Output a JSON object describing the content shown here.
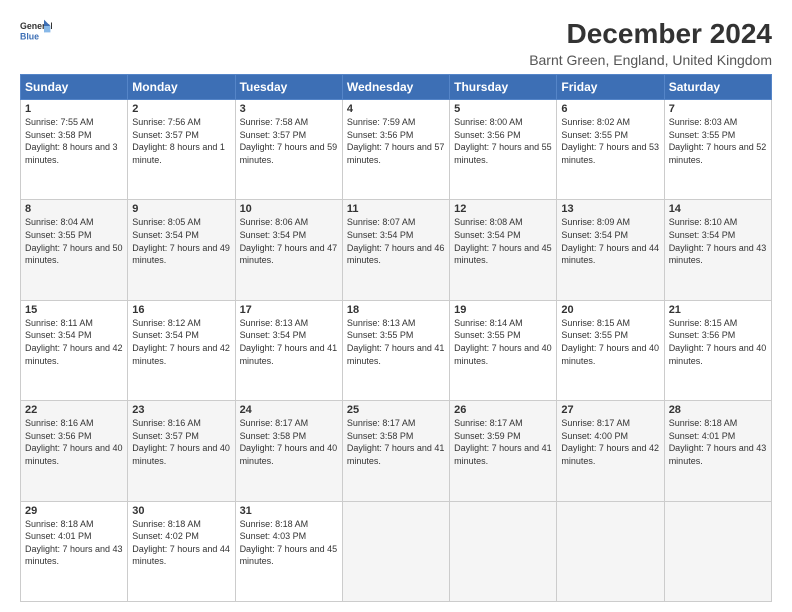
{
  "logo": {
    "line1": "General",
    "line2": "Blue"
  },
  "title": "December 2024",
  "subtitle": "Barnt Green, England, United Kingdom",
  "days_of_week": [
    "Sunday",
    "Monday",
    "Tuesday",
    "Wednesday",
    "Thursday",
    "Friday",
    "Saturday"
  ],
  "weeks": [
    [
      {
        "day": "1",
        "sunrise": "7:55 AM",
        "sunset": "3:58 PM",
        "daylight": "8 hours and 3 minutes."
      },
      {
        "day": "2",
        "sunrise": "7:56 AM",
        "sunset": "3:57 PM",
        "daylight": "8 hours and 1 minute."
      },
      {
        "day": "3",
        "sunrise": "7:58 AM",
        "sunset": "3:57 PM",
        "daylight": "7 hours and 59 minutes."
      },
      {
        "day": "4",
        "sunrise": "7:59 AM",
        "sunset": "3:56 PM",
        "daylight": "7 hours and 57 minutes."
      },
      {
        "day": "5",
        "sunrise": "8:00 AM",
        "sunset": "3:56 PM",
        "daylight": "7 hours and 55 minutes."
      },
      {
        "day": "6",
        "sunrise": "8:02 AM",
        "sunset": "3:55 PM",
        "daylight": "7 hours and 53 minutes."
      },
      {
        "day": "7",
        "sunrise": "8:03 AM",
        "sunset": "3:55 PM",
        "daylight": "7 hours and 52 minutes."
      }
    ],
    [
      {
        "day": "8",
        "sunrise": "8:04 AM",
        "sunset": "3:55 PM",
        "daylight": "7 hours and 50 minutes."
      },
      {
        "day": "9",
        "sunrise": "8:05 AM",
        "sunset": "3:54 PM",
        "daylight": "7 hours and 49 minutes."
      },
      {
        "day": "10",
        "sunrise": "8:06 AM",
        "sunset": "3:54 PM",
        "daylight": "7 hours and 47 minutes."
      },
      {
        "day": "11",
        "sunrise": "8:07 AM",
        "sunset": "3:54 PM",
        "daylight": "7 hours and 46 minutes."
      },
      {
        "day": "12",
        "sunrise": "8:08 AM",
        "sunset": "3:54 PM",
        "daylight": "7 hours and 45 minutes."
      },
      {
        "day": "13",
        "sunrise": "8:09 AM",
        "sunset": "3:54 PM",
        "daylight": "7 hours and 44 minutes."
      },
      {
        "day": "14",
        "sunrise": "8:10 AM",
        "sunset": "3:54 PM",
        "daylight": "7 hours and 43 minutes."
      }
    ],
    [
      {
        "day": "15",
        "sunrise": "8:11 AM",
        "sunset": "3:54 PM",
        "daylight": "7 hours and 42 minutes."
      },
      {
        "day": "16",
        "sunrise": "8:12 AM",
        "sunset": "3:54 PM",
        "daylight": "7 hours and 42 minutes."
      },
      {
        "day": "17",
        "sunrise": "8:13 AM",
        "sunset": "3:54 PM",
        "daylight": "7 hours and 41 minutes."
      },
      {
        "day": "18",
        "sunrise": "8:13 AM",
        "sunset": "3:55 PM",
        "daylight": "7 hours and 41 minutes."
      },
      {
        "day": "19",
        "sunrise": "8:14 AM",
        "sunset": "3:55 PM",
        "daylight": "7 hours and 40 minutes."
      },
      {
        "day": "20",
        "sunrise": "8:15 AM",
        "sunset": "3:55 PM",
        "daylight": "7 hours and 40 minutes."
      },
      {
        "day": "21",
        "sunrise": "8:15 AM",
        "sunset": "3:56 PM",
        "daylight": "7 hours and 40 minutes."
      }
    ],
    [
      {
        "day": "22",
        "sunrise": "8:16 AM",
        "sunset": "3:56 PM",
        "daylight": "7 hours and 40 minutes."
      },
      {
        "day": "23",
        "sunrise": "8:16 AM",
        "sunset": "3:57 PM",
        "daylight": "7 hours and 40 minutes."
      },
      {
        "day": "24",
        "sunrise": "8:17 AM",
        "sunset": "3:58 PM",
        "daylight": "7 hours and 40 minutes."
      },
      {
        "day": "25",
        "sunrise": "8:17 AM",
        "sunset": "3:58 PM",
        "daylight": "7 hours and 41 minutes."
      },
      {
        "day": "26",
        "sunrise": "8:17 AM",
        "sunset": "3:59 PM",
        "daylight": "7 hours and 41 minutes."
      },
      {
        "day": "27",
        "sunrise": "8:17 AM",
        "sunset": "4:00 PM",
        "daylight": "7 hours and 42 minutes."
      },
      {
        "day": "28",
        "sunrise": "8:18 AM",
        "sunset": "4:01 PM",
        "daylight": "7 hours and 43 minutes."
      }
    ],
    [
      {
        "day": "29",
        "sunrise": "8:18 AM",
        "sunset": "4:01 PM",
        "daylight": "7 hours and 43 minutes."
      },
      {
        "day": "30",
        "sunrise": "8:18 AM",
        "sunset": "4:02 PM",
        "daylight": "7 hours and 44 minutes."
      },
      {
        "day": "31",
        "sunrise": "8:18 AM",
        "sunset": "4:03 PM",
        "daylight": "7 hours and 45 minutes."
      },
      null,
      null,
      null,
      null
    ]
  ]
}
